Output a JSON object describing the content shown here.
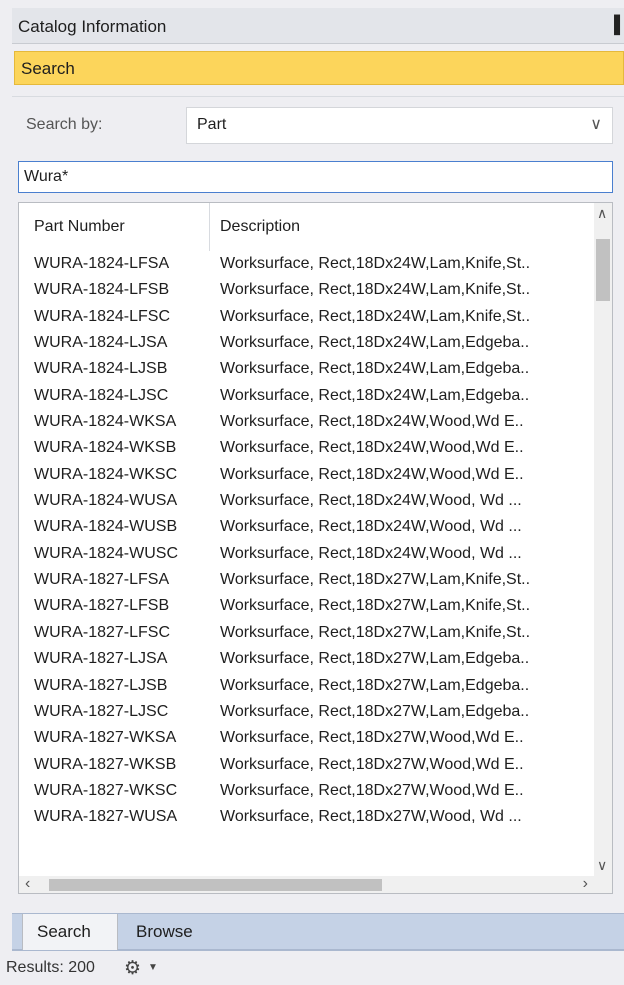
{
  "window": {
    "title": "Catalog Information",
    "pin_icon": "pin-icon"
  },
  "search_header": {
    "label": "Search"
  },
  "search_by": {
    "label": "Search by:",
    "value": "Part"
  },
  "search_input": {
    "value": "Wura*"
  },
  "grid": {
    "columns": [
      "Part Number",
      "Description"
    ],
    "rows": [
      [
        "WURA-1824-LFSA",
        "Worksurface, Rect,18Dx24W,Lam,Knife,St.."
      ],
      [
        "WURA-1824-LFSB",
        "Worksurface, Rect,18Dx24W,Lam,Knife,St.."
      ],
      [
        "WURA-1824-LFSC",
        "Worksurface, Rect,18Dx24W,Lam,Knife,St.."
      ],
      [
        "WURA-1824-LJSA",
        "Worksurface, Rect,18Dx24W,Lam,Edgeba.."
      ],
      [
        "WURA-1824-LJSB",
        "Worksurface, Rect,18Dx24W,Lam,Edgeba.."
      ],
      [
        "WURA-1824-LJSC",
        "Worksurface, Rect,18Dx24W,Lam,Edgeba.."
      ],
      [
        "WURA-1824-WKSA",
        "Worksurface, Rect,18Dx24W,Wood,Wd E.."
      ],
      [
        "WURA-1824-WKSB",
        "Worksurface, Rect,18Dx24W,Wood,Wd E.."
      ],
      [
        "WURA-1824-WKSC",
        "Worksurface, Rect,18Dx24W,Wood,Wd E.."
      ],
      [
        "WURA-1824-WUSA",
        "Worksurface, Rect,18Dx24W,Wood, Wd ..."
      ],
      [
        "WURA-1824-WUSB",
        "Worksurface, Rect,18Dx24W,Wood, Wd ..."
      ],
      [
        "WURA-1824-WUSC",
        "Worksurface, Rect,18Dx24W,Wood, Wd ..."
      ],
      [
        "WURA-1827-LFSA",
        "Worksurface, Rect,18Dx27W,Lam,Knife,St.."
      ],
      [
        "WURA-1827-LFSB",
        "Worksurface, Rect,18Dx27W,Lam,Knife,St.."
      ],
      [
        "WURA-1827-LFSC",
        "Worksurface, Rect,18Dx27W,Lam,Knife,St.."
      ],
      [
        "WURA-1827-LJSA",
        "Worksurface, Rect,18Dx27W,Lam,Edgeba.."
      ],
      [
        "WURA-1827-LJSB",
        "Worksurface, Rect,18Dx27W,Lam,Edgeba.."
      ],
      [
        "WURA-1827-LJSC",
        "Worksurface, Rect,18Dx27W,Lam,Edgeba.."
      ],
      [
        "WURA-1827-WKSA",
        "Worksurface, Rect,18Dx27W,Wood,Wd E.."
      ],
      [
        "WURA-1827-WKSB",
        "Worksurface, Rect,18Dx27W,Wood,Wd E.."
      ],
      [
        "WURA-1827-WKSC",
        "Worksurface, Rect,18Dx27W,Wood,Wd E.."
      ],
      [
        "WURA-1827-WUSA",
        "Worksurface, Rect,18Dx27W,Wood, Wd ..."
      ]
    ]
  },
  "tabs": [
    {
      "label": "Search",
      "active": true
    },
    {
      "label": "Browse",
      "active": false
    }
  ],
  "status": {
    "results": "Results: 200",
    "gear_icon": "gear-icon"
  },
  "colors": {
    "search_header": "#fcd55b",
    "tabstrip": "#c5d2e6",
    "input_border": "#4a7fcf"
  }
}
